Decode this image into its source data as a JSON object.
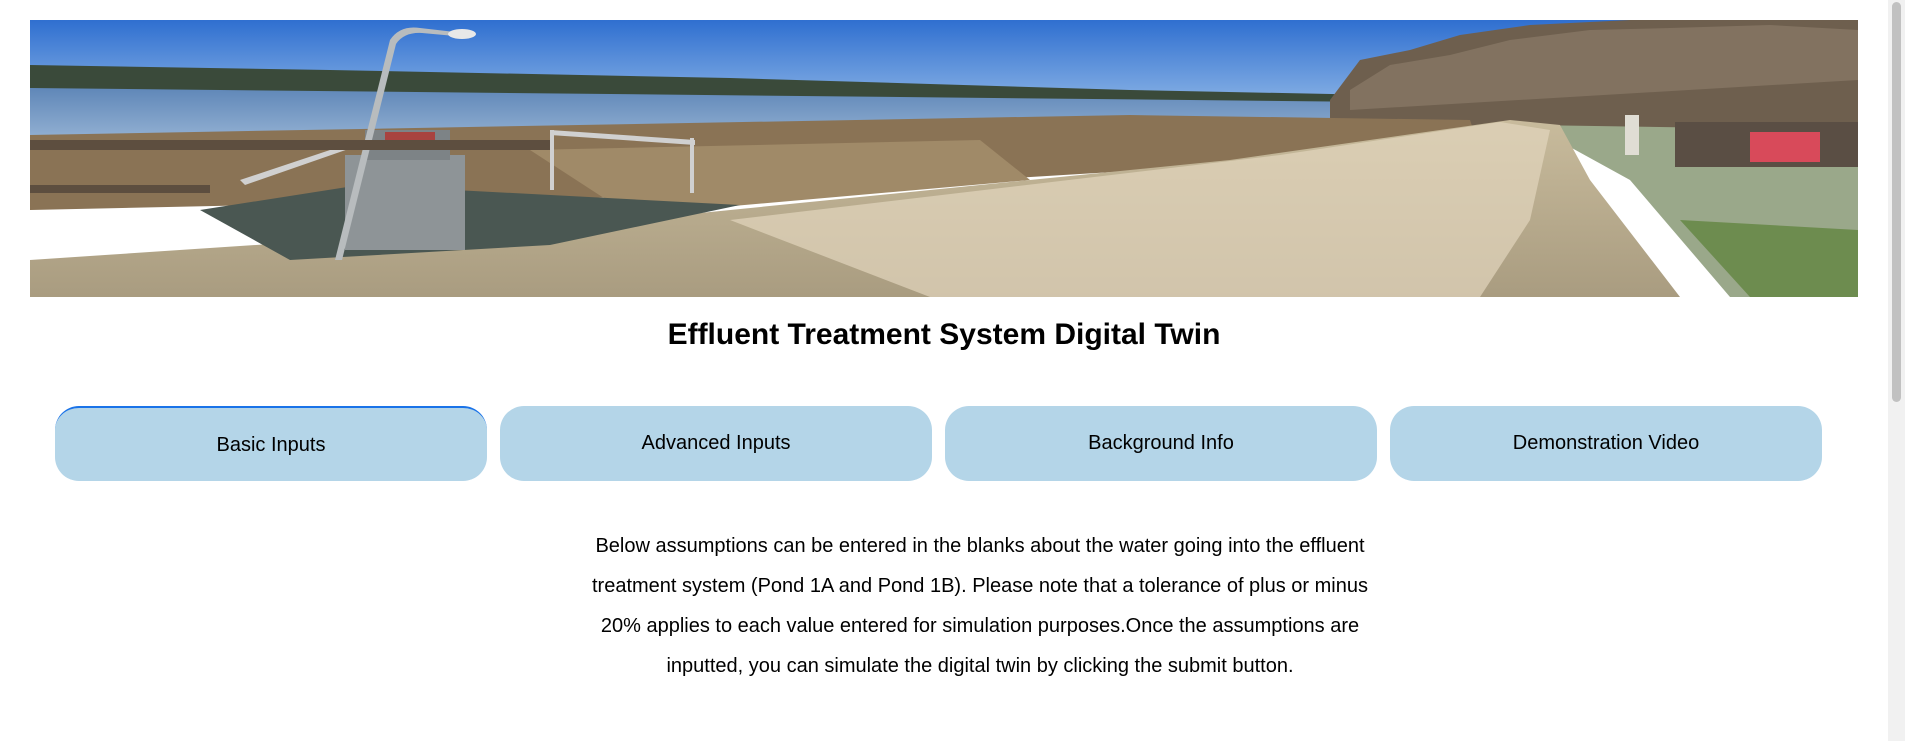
{
  "page": {
    "title": "Effluent Treatment System Digital Twin"
  },
  "banner": {
    "image_description_icon": "pond-landscape-photo"
  },
  "tabs": [
    {
      "label": "Basic Inputs",
      "active": true
    },
    {
      "label": "Advanced Inputs",
      "active": false
    },
    {
      "label": "Background Info",
      "active": false
    },
    {
      "label": "Demonstration Video",
      "active": false
    }
  ],
  "intro": {
    "text": "Below assumptions can be entered in the blanks about the water going into the effluent treatment system (Pond 1A and Pond 1B). Please note that a tolerance of plus or minus 20% applies to each value entered for simulation purposes.Once the assumptions are inputted, you can simulate the digital twin by clicking the submit button."
  },
  "colors": {
    "tab_background": "#b4d5e8",
    "active_tab_border": "#1a73e8",
    "sky": "#4a86d8",
    "water": "#8fb2d6",
    "dirt_road": "#d9cdb4"
  }
}
